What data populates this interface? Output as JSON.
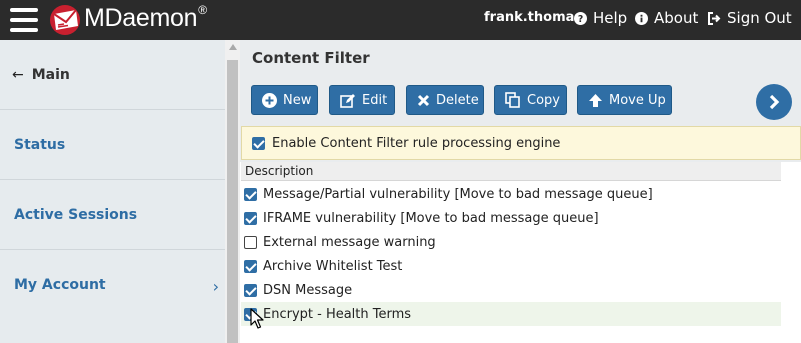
{
  "header": {
    "brand": "MDaemon",
    "brand_mark": "®",
    "user": "frank.thomas",
    "help": "Help",
    "about": "About",
    "sign_out": "Sign Out"
  },
  "sidebar": {
    "main": "Main",
    "items": [
      "Status",
      "Active Sessions",
      "My Account"
    ]
  },
  "content": {
    "title": "Content Filter",
    "buttons": {
      "new": "New",
      "edit": "Edit",
      "delete": "Delete",
      "copy": "Copy",
      "move_up": "Move Up"
    },
    "enable": {
      "label": "Enable Content Filter rule processing engine",
      "checked": true
    },
    "column": "Description",
    "rules": [
      {
        "label": "Message/Partial vulnerability [Move to bad message queue]",
        "checked": true
      },
      {
        "label": "IFRAME vulnerability [Move to bad message queue]",
        "checked": true
      },
      {
        "label": "External message warning",
        "checked": false
      },
      {
        "label": "Archive Whitelist Test",
        "checked": true
      },
      {
        "label": "DSN Message",
        "checked": true
      },
      {
        "label": "Encrypt - Health Terms",
        "checked": true
      }
    ]
  },
  "colors": {
    "topbar": "#2b2b2b",
    "accent": "#2f6ea5",
    "brand_red": "#c8202f",
    "sidebar_bg": "#e6ebee",
    "enable_bg": "#fdf8dc",
    "row_highlight": "#eef5ea"
  },
  "icons": {
    "menu": "hamburger-icon",
    "logo": "envelope-logo-icon",
    "help": "question-circle-icon",
    "about": "info-circle-icon",
    "sign_out": "sign-out-icon",
    "back": "arrow-left-icon",
    "chevron": "chevron-right-icon",
    "new": "plus-circle-icon",
    "edit": "edit-icon",
    "delete": "x-icon",
    "copy": "copy-icon",
    "move_up": "arrow-up-icon",
    "next": "chevron-circle-right-icon"
  }
}
